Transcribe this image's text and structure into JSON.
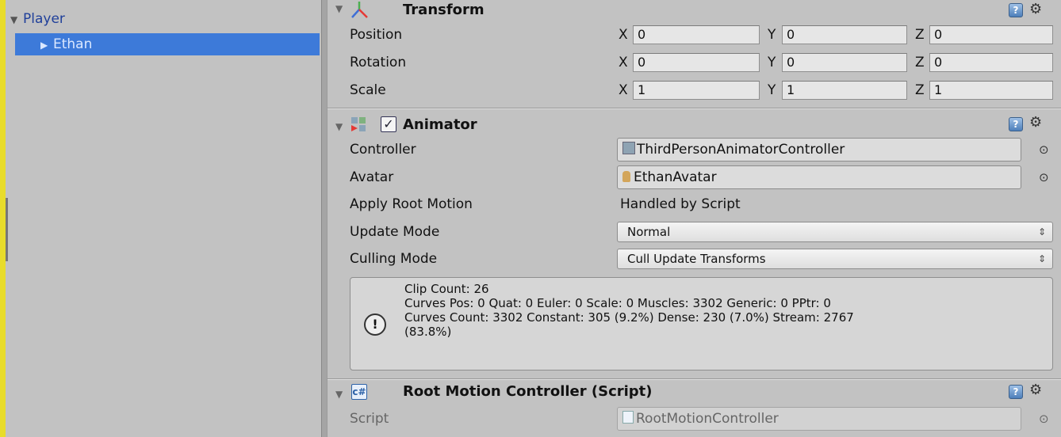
{
  "hierarchy": {
    "items": [
      {
        "label": "Player"
      },
      {
        "label": "Ethan"
      }
    ]
  },
  "transform": {
    "title": "Transform",
    "rows": [
      {
        "label": "Position",
        "x": "0",
        "y": "0",
        "z": "0"
      },
      {
        "label": "Rotation",
        "x": "0",
        "y": "0",
        "z": "0"
      },
      {
        "label": "Scale",
        "x": "1",
        "y": "1",
        "z": "1"
      }
    ],
    "axis": {
      "x": "X",
      "y": "Y",
      "z": "Z"
    }
  },
  "animator": {
    "title": "Animator",
    "enabled": true,
    "controller_label": "Controller",
    "controller_value": "ThirdPersonAnimatorController",
    "avatar_label": "Avatar",
    "avatar_value": "EthanAvatar",
    "root_motion_label": "Apply Root Motion",
    "root_motion_value": "Handled by Script",
    "update_mode_label": "Update Mode",
    "update_mode_value": "Normal",
    "culling_mode_label": "Culling Mode",
    "culling_mode_value": "Cull Update Transforms",
    "info": {
      "line1": "Clip Count: 26",
      "line2": "Curves Pos: 0 Quat: 0 Euler: 0 Scale: 0 Muscles: 3302 Generic: 0 PPtr: 0",
      "line3": "Curves Count: 3302 Constant: 305 (9.2%) Dense: 230 (7.0%) Stream: 2767",
      "line4": "(83.8%)"
    }
  },
  "script_component": {
    "title": "Root Motion Controller (Script)",
    "script_label": "Script",
    "script_value": "RootMotionController"
  },
  "icons": {
    "help": "?",
    "gear": "⚙",
    "picker": "⊙",
    "info": "!",
    "fold_open": "▼",
    "fold_closed": "▶",
    "dropdown": "⇕"
  },
  "colors": {
    "selection": "#3d7ad9",
    "background": "#c2c2c2"
  }
}
